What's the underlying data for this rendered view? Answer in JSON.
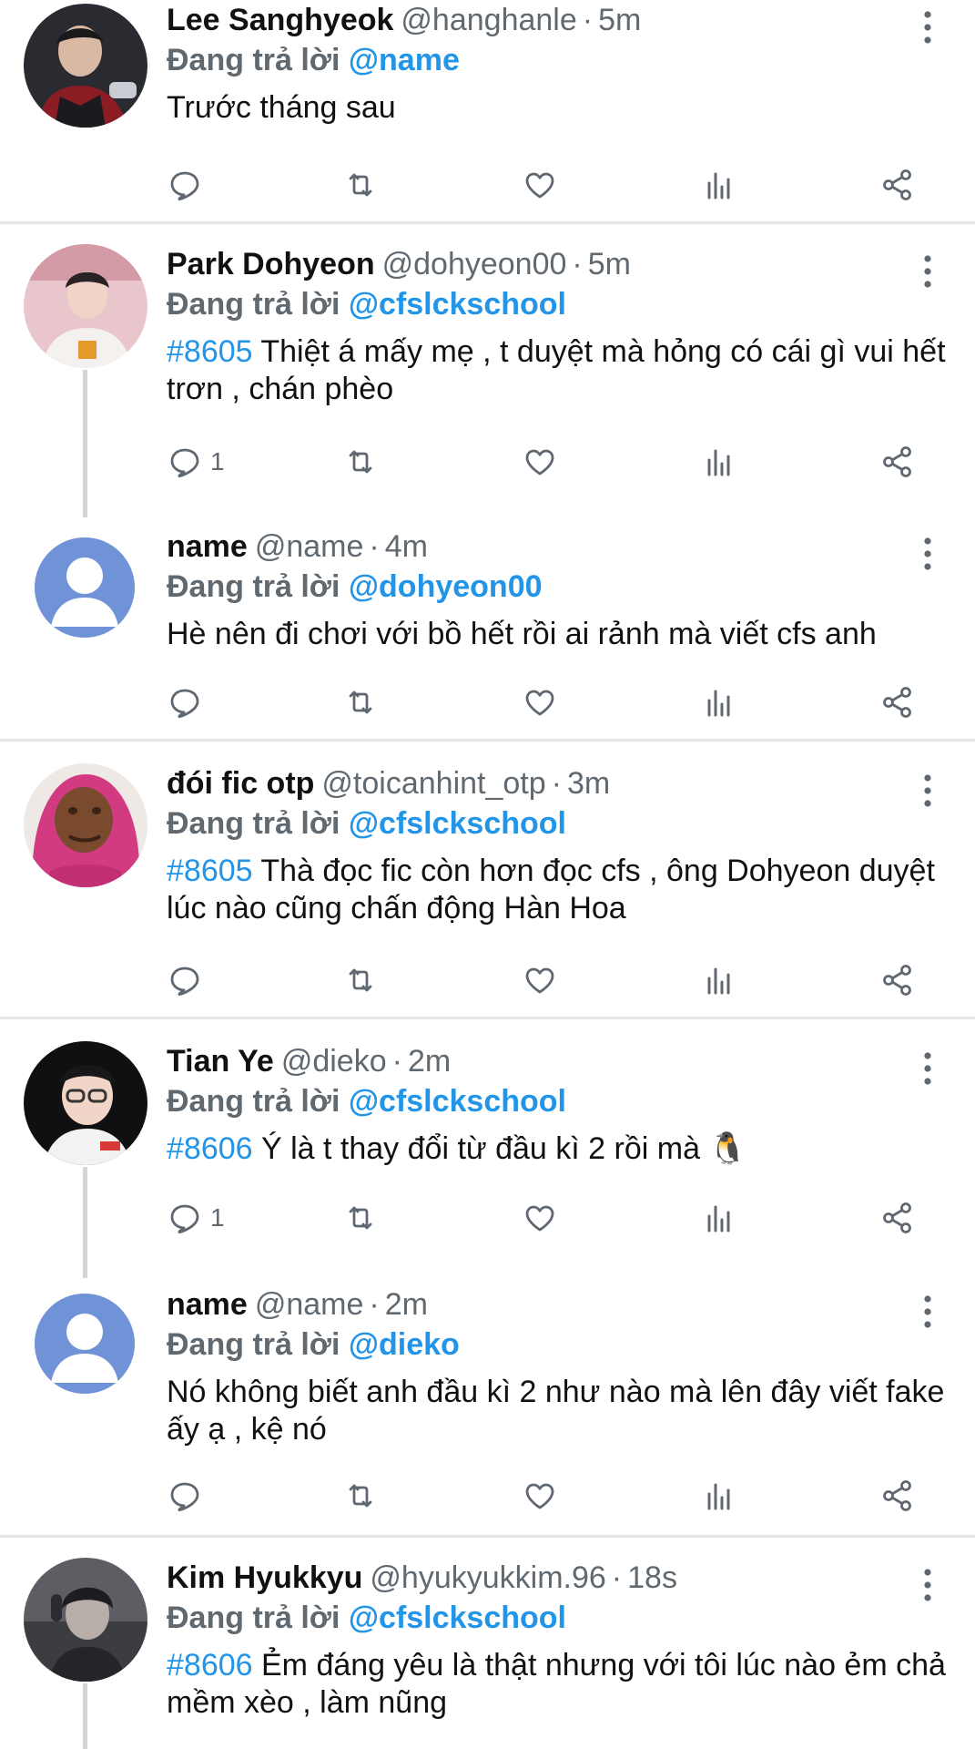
{
  "reply_prefix": "Đang trả lời",
  "tweets": [
    {
      "name": "Lee Sanghyeok",
      "handle": "@hanghanle",
      "time": "5m",
      "reply_to": "@name",
      "hashtag": "",
      "text": "Trước tháng sau",
      "reply_count": "",
      "avatar": "photo-avatar-dark"
    },
    {
      "name": "Park Dohyeon",
      "handle": "@dohyeon00",
      "time": "5m",
      "reply_to": "@cfslckschool",
      "hashtag": "#8605",
      "text": " Thiệt á mấy mẹ , t duyệt mà hỏng có cái gì vui hết trơn , chán phèo",
      "reply_count": "1",
      "avatar": "photo-avatar-light"
    },
    {
      "name": "name",
      "handle": "@name",
      "time": "4m",
      "reply_to": "@dohyeon00",
      "hashtag": "",
      "text": "Hè nên đi chơi với bồ hết rồi ai rảnh mà viết cfs anh",
      "reply_count": "",
      "avatar": "default-user-avatar"
    },
    {
      "name": "đói fic otp",
      "handle": "@toicanhint_otp",
      "time": "3m",
      "reply_to": "@cfslckschool",
      "hashtag": "#8605",
      "text": " Thà đọc fic còn hơn đọc cfs , ông Dohyeon duyệt lúc nào cũng chấn động Hàn Hoa",
      "reply_count": "",
      "avatar": "pink-hood-avatar"
    },
    {
      "name": "Tian Ye",
      "handle": "@dieko",
      "time": "2m",
      "reply_to": "@cfslckschool",
      "hashtag": "#8606",
      "text": " Ý là t thay đổi từ đầu kì 2 rồi mà 🐧",
      "reply_count": "1",
      "avatar": "photo-avatar-glasses"
    },
    {
      "name": "name",
      "handle": "@name",
      "time": "2m",
      "reply_to": "@dieko",
      "hashtag": "",
      "text": "Nó không biết anh đầu kì 2 như nào mà lên đây viết fake ấy ạ , kệ nó",
      "reply_count": "",
      "avatar": "default-user-avatar"
    },
    {
      "name": "Kim Hyukkyu",
      "handle": "@hyukyukkim.96",
      "time": "18s",
      "reply_to": "@cfslckschool",
      "hashtag": "#8606",
      "text": " Ẻm đáng yêu là thật nhưng với tôi lúc nào ẻm chả mềm xèo , làm nũng",
      "reply_count": "",
      "avatar": "photo-avatar-gray"
    }
  ],
  "colors": {
    "link": "#2295e8",
    "muted": "#606870",
    "divider": "#e3e6e9",
    "thread_line": "#d2d6db"
  },
  "icons": [
    "reply-icon",
    "retweet-icon",
    "like-icon",
    "stats-icon",
    "share-icon",
    "more-options-icon"
  ]
}
